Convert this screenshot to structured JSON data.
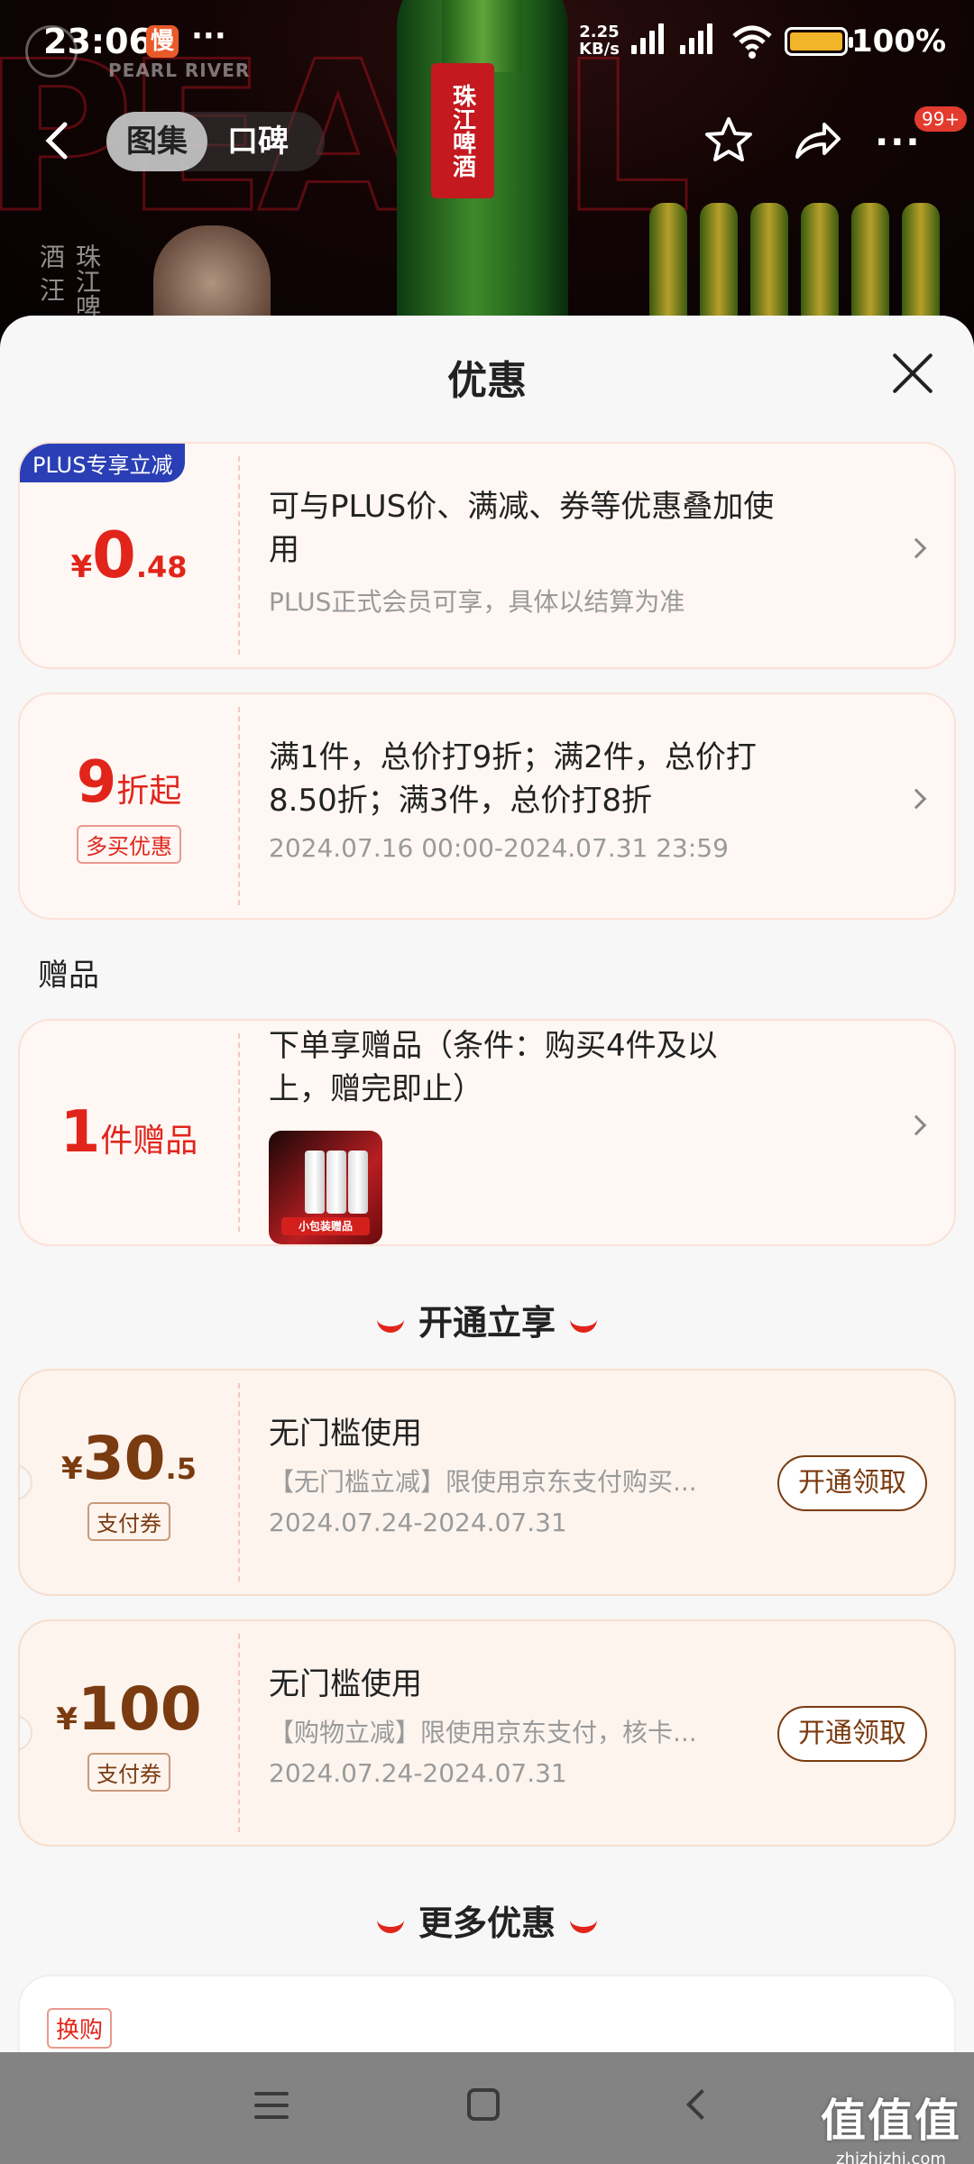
{
  "status_bar": {
    "time": "23:06",
    "app_badge": "慢",
    "dots": "···",
    "speed_value": "2.25",
    "speed_unit": "KB/s",
    "battery_percent": "100%",
    "battery_level": 1.0
  },
  "banner": {
    "brand_en": "PEARL RIVER",
    "bottle_label": "珠江啤酒",
    "side_text": "珠江啤酒 汪"
  },
  "nav": {
    "tabs": [
      {
        "label": "图集",
        "active": true
      },
      {
        "label": "口碑",
        "active": false
      }
    ],
    "badge": "99+"
  },
  "sheet": {
    "title": "优惠"
  },
  "offers": [
    {
      "tag": "PLUS专享立减",
      "price_symbol": "¥",
      "price_int": "0",
      "price_dec": ".48",
      "title": "可与PLUS价、满减、券等优惠叠加使用",
      "sub": "PLUS正式会员可享，具体以结算为准"
    },
    {
      "price_int": "9",
      "price_unit": "折起",
      "label": "多买优惠",
      "title": "满1件，总价打9折；满2件，总价打8.50折；满3件，总价打8折",
      "sub": "2024.07.16 00:00-2024.07.31 23:59"
    }
  ],
  "gifts": {
    "section_label": "赠品",
    "price_int": "1",
    "price_unit": "件赠品",
    "title": "下单享赠品（条件：购买4件及以上，赠完即止）",
    "thumb_caption": "小包装赠品"
  },
  "open_section": {
    "heading": "开通立享",
    "coupons": [
      {
        "price_symbol": "¥",
        "price_int": "30",
        "price_dec": ".5",
        "label": "支付券",
        "title": "无门槛使用",
        "desc": "【无门槛立减】限使用京东支付购买...",
        "date": "2024.07.24-2024.07.31",
        "button": "开通领取"
      },
      {
        "price_symbol": "¥",
        "price_int": "100",
        "price_dec": "",
        "label": "支付券",
        "title": "无门槛使用",
        "desc": "【购物立减】限使用京东支付，核卡...",
        "date": "2024.07.24-2024.07.31",
        "button": "开通领取"
      }
    ]
  },
  "more_section": {
    "heading": "更多优惠",
    "first_tag": "换购"
  },
  "watermark": {
    "big": "值值值",
    "small": "zhizhizhi.com"
  },
  "colors": {
    "accent_red": "#e1251b",
    "coupon_brown": "#7a3b10",
    "plus_blue": "#2a3fb5",
    "battery_yellow": "#f2b428"
  }
}
